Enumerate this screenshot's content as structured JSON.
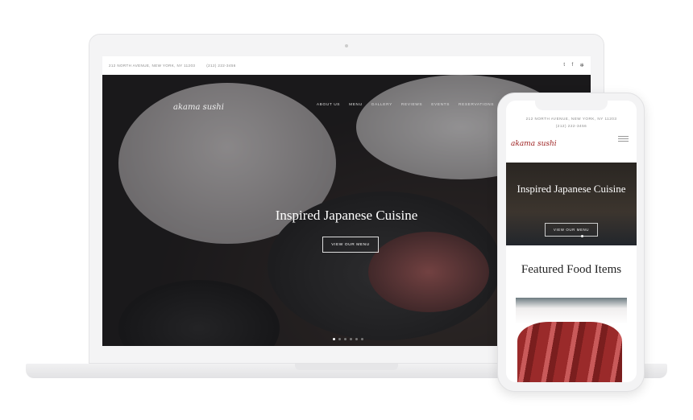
{
  "desktop": {
    "address": "212 NORTH AVENUE, NEW YORK, NY 11203",
    "phone": "(212) 222-3456",
    "social": [
      {
        "icon": "twitter-icon",
        "glyph": "🐦"
      },
      {
        "icon": "facebook-icon",
        "glyph": "f"
      },
      {
        "icon": "yelp-icon",
        "glyph": "✻"
      }
    ],
    "logo": "akama sushi",
    "nav": [
      "ABOUT US",
      "MENU",
      "GALLERY",
      "REVIEWS",
      "EVENTS",
      "RESERVATIONS"
    ],
    "hero_title": "Inspired Japanese Cuisine",
    "hero_button": "VIEW OUR MENU",
    "slides": 6,
    "active_slide": 1
  },
  "mobile": {
    "address": "212 NORTH AVENUE, NEW YORK, NY 11203",
    "phone": "(212) 222-3456",
    "logo": "akama sushi",
    "hero_title": "Inspired Japanese Cuisine",
    "hero_button": "VIEW OUR MENU",
    "featured_title": "Featured Food Items"
  },
  "colors": {
    "logo_mobile": "#9b1c1c"
  }
}
